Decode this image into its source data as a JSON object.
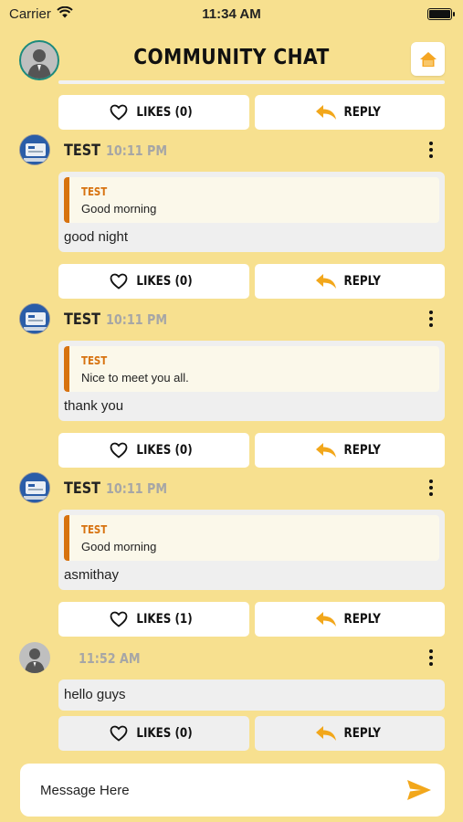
{
  "status_bar": {
    "carrier": "Carrier",
    "time": "11:34 AM"
  },
  "header": {
    "title": "COMMUNITY CHAT",
    "home_icon": "home-icon",
    "accent": "#f5a623"
  },
  "actions": {
    "reply_label": "REPLY",
    "heart_icon": "heart-outline-icon",
    "reply_icon": "reply-arrow-icon",
    "reply_color": "#f2a71b"
  },
  "first_actions": {
    "likes_label": "LIKES (0)"
  },
  "messages": [
    {
      "user": "TEST",
      "time": "10:11 PM",
      "quote_user": "TEST",
      "quote_text": "Good morning",
      "text": "good night",
      "likes_label": "LIKES (0)"
    },
    {
      "user": "TEST",
      "time": "10:11 PM",
      "quote_user": "TEST",
      "quote_text": "Nice to meet you all.",
      "text": "thank you",
      "likes_label": "LIKES (0)"
    },
    {
      "user": "TEST",
      "time": "10:11 PM",
      "quote_user": "TEST",
      "quote_text": "Good morning",
      "text": "asmithay",
      "likes_label": "LIKES (1)"
    },
    {
      "user": "",
      "time": "11:52 AM",
      "text": "hello guys",
      "likes_label": "LIKES (0)"
    }
  ],
  "composer": {
    "placeholder": "Message Here",
    "send_icon": "send-icon",
    "send_color": "#f2a71b"
  },
  "colors": {
    "background": "#f7e08f",
    "quote_bar": "#d7720f"
  }
}
